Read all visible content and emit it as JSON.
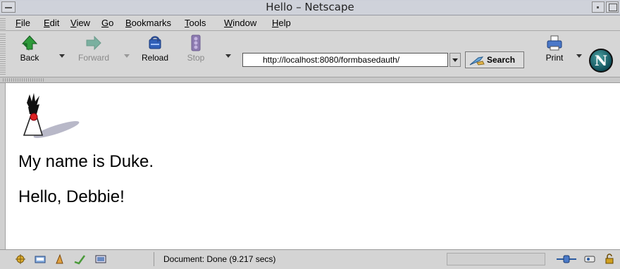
{
  "window": {
    "title": "Hello – Netscape"
  },
  "menu": {
    "items": [
      {
        "pre": "",
        "key": "F",
        "post": "ile"
      },
      {
        "pre": "",
        "key": "E",
        "post": "dit"
      },
      {
        "pre": "",
        "key": "V",
        "post": "iew"
      },
      {
        "pre": "",
        "key": "G",
        "post": "o"
      },
      {
        "pre": "",
        "key": "B",
        "post": "ookmarks"
      },
      {
        "pre": "",
        "key": "T",
        "post": "ools"
      },
      {
        "pre": "",
        "key": "W",
        "post": "indow"
      },
      {
        "pre": "",
        "key": "H",
        "post": "elp"
      }
    ]
  },
  "toolbar": {
    "back_label": "Back",
    "forward_label": "Forward",
    "reload_label": "Reload",
    "stop_label": "Stop",
    "url_value": "http://localhost:8080/formbasedauth/",
    "search_label": "Search",
    "print_label": "Print",
    "netscape_logo_letter": "N"
  },
  "page": {
    "line1": "My name is Duke.",
    "line2": "Hello, Debbie!"
  },
  "status": {
    "text": "Document: Done (9.217 secs)"
  },
  "colors": {
    "back_arrow": "#2e9a3a",
    "forward_arrow": "#7ab0a0",
    "netscape_logo": "#0f4f5a",
    "duke_nose": "#d22"
  }
}
